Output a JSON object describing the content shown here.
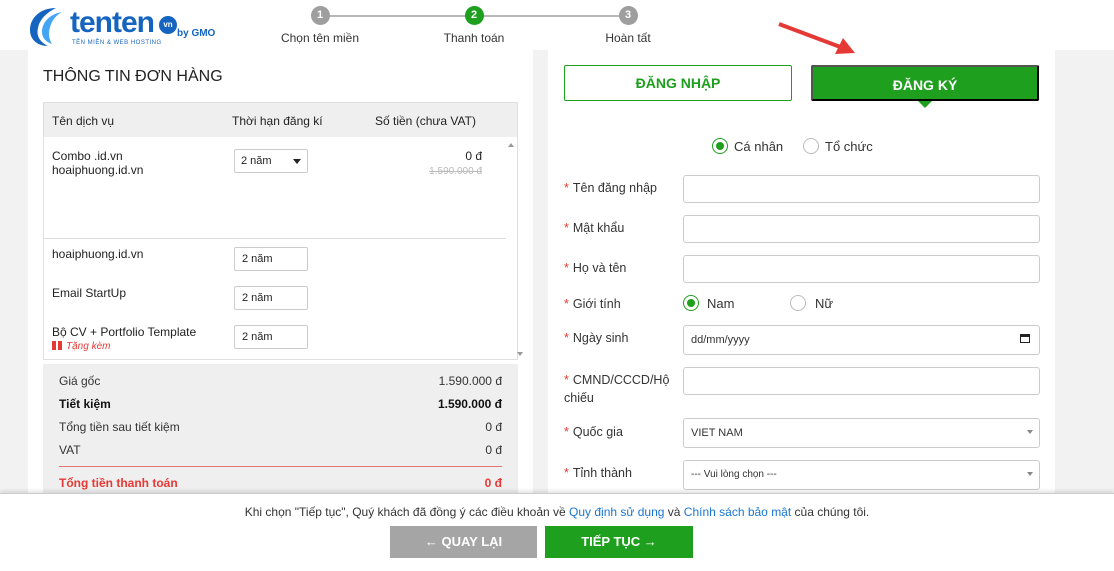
{
  "brand": {
    "name": "tenten",
    "tld": "vn",
    "by": "by GMO",
    "tagline": "TÊN MIỀN & WEB HOSTING",
    "color": "#1565c0"
  },
  "steps": [
    {
      "num": "1",
      "label": "Chọn tên miền"
    },
    {
      "num": "2",
      "label": "Thanh toán"
    },
    {
      "num": "3",
      "label": "Hoàn tất"
    }
  ],
  "order": {
    "title": "THÔNG TIN ĐƠN HÀNG",
    "headers": {
      "service": "Tên dịch vụ",
      "term": "Thời hạn đăng kí",
      "amount": "Số tiền (chưa VAT)"
    },
    "items": [
      {
        "name": "Combo .id.vn",
        "sub": "hoaiphuong.id.vn",
        "term": "2 năm",
        "price": "0 đ",
        "old_price": "1.590.000 đ"
      },
      {
        "name": "hoaiphuong.id.vn",
        "term": "2 năm"
      },
      {
        "name": "Email StartUp",
        "term": "2 năm"
      },
      {
        "name": "Bộ CV + Portfolio Template",
        "gift": "Tặng kèm",
        "term": "2 năm"
      }
    ],
    "summary": {
      "original_label": "Giá gốc",
      "original_value": "1.590.000 đ",
      "saving_label": "Tiết kiệm",
      "saving_value": "1.590.000 đ",
      "after_label": "Tổng tiền sau tiết kiệm",
      "after_value": "0 đ",
      "vat_label": "VAT",
      "vat_value": "0 đ",
      "total_label": "Tổng tiền thanh toán",
      "total_value": "0 đ"
    }
  },
  "auth": {
    "login_label": "ĐĂNG NHẬP",
    "register_label": "ĐĂNG KÝ",
    "account_type": {
      "personal": "Cá nhân",
      "org": "Tổ chức",
      "selected": "personal"
    },
    "fields": {
      "username": "Tên đăng nhập",
      "password": "Mật khẩu",
      "fullname": "Họ và tên",
      "gender": "Giới tính",
      "gender_male": "Nam",
      "gender_female": "Nữ",
      "birthday": "Ngày sinh",
      "birthday_placeholder": "dd/mm/yyyy",
      "id_card": "CMND/CCCD/Hộ chiếu",
      "country": "Quốc gia",
      "country_value": "VIET NAM",
      "province": "Tỉnh thành",
      "province_placeholder": "--- Vui lòng chọn ---"
    },
    "required_mark": "*"
  },
  "footer": {
    "terms_prefix": "Khi chọn \"Tiếp tục\", Quý khách đã đồng ý các điều khoản về ",
    "terms_link1": "Quy định sử dụng",
    "terms_mid": " và ",
    "terms_link2": "Chính sách bảo mật",
    "terms_suffix": " của chúng tôi.",
    "back_label": "← QUAY LẠI",
    "next_label": "TIẾP TỤC →"
  },
  "colors": {
    "accent": "#1ea01e",
    "danger": "#e53935",
    "link": "#1976d2"
  }
}
